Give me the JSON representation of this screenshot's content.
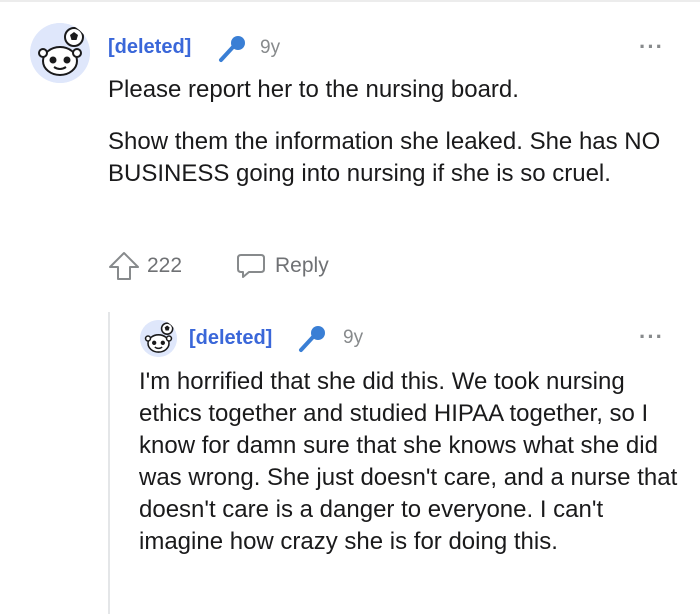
{
  "comment": {
    "author": "[deleted]",
    "time": "9y",
    "paragraphs": [
      "Please report her to the nursing board.",
      "Show them the information she leaked. She has NO BUSINESS going into nursing if she is so cruel."
    ],
    "score": "222",
    "reply_label": "Reply",
    "more_label": "···"
  },
  "reply": {
    "author": "[deleted]",
    "time": "9y",
    "body": "I'm horrified that she did this. We took nursing ethics together and studied HIPAA together, so I know for damn sure that she knows what she did was wrong. She just doesn't care, and a nurse that doesn't care is a danger to everyone. I can't imagine how crazy she is for doing this.",
    "more_label": "···"
  },
  "colors": {
    "author": "#3a67d9",
    "mic": "#3a7fd5",
    "meta": "#878a8c",
    "text": "#1a1a1b"
  },
  "icons": [
    "snoo-avatar-icon",
    "microphone-icon",
    "upvote-icon",
    "reply-icon",
    "more-options-icon"
  ]
}
